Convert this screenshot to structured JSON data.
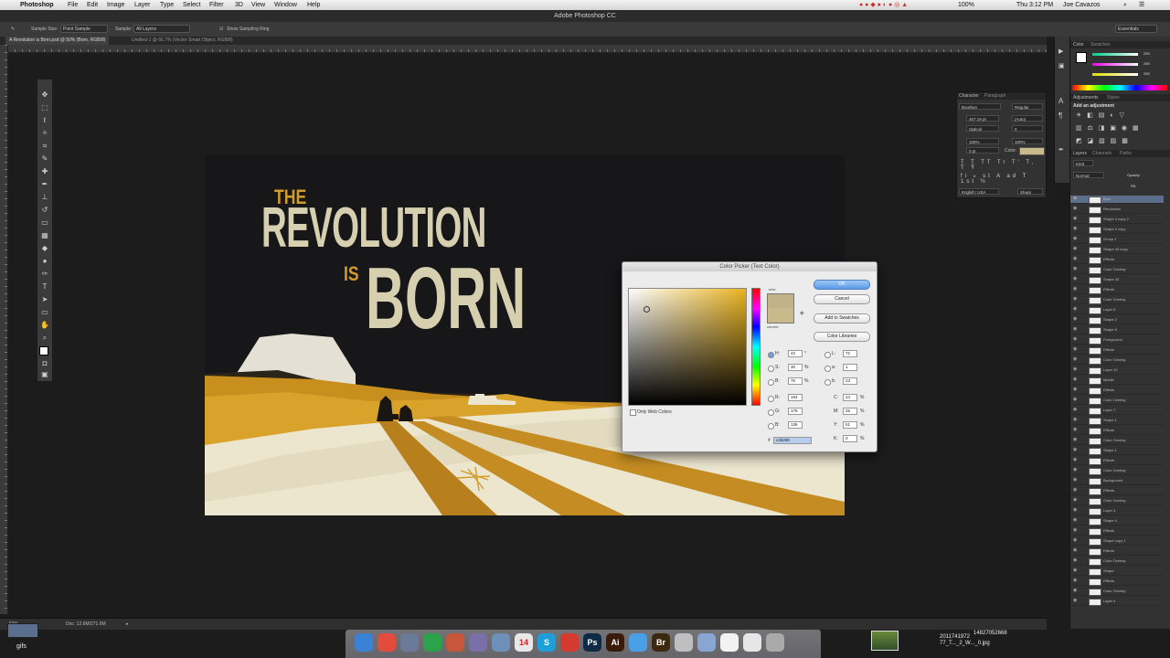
{
  "menubar": {
    "apple": "",
    "app": "Photoshop",
    "items": [
      "File",
      "Edit",
      "Image",
      "Layer",
      "Type",
      "Select",
      "Filter",
      "3D",
      "View",
      "Window",
      "Help"
    ],
    "battery": "100%",
    "clock": "Thu 3:12 PM",
    "user": "Joe Cavazos"
  },
  "window": {
    "title": "Adobe Photoshop CC"
  },
  "options": {
    "sample_size_label": "Sample Size:",
    "sample_size_value": "Point Sample",
    "sample_label": "Sample:",
    "sample_value": "All Layers",
    "show_ring": "Show Sampling Ring",
    "workspace": "Essentials"
  },
  "tabs": [
    {
      "label": "A Revolution is Born.psd @ 50% (Born, RGB/8)"
    },
    {
      "label": "Untitled-1 @ 66.7% (Vector Smart Object, RGB/8)"
    }
  ],
  "status": {
    "zoom": "50%",
    "doc": "Doc: 12.6M/271.9M"
  },
  "artwork": {
    "the": "THE",
    "revolution": "REVOLUTION",
    "is": "IS",
    "born": "BORN",
    "colors": {
      "gold": "#d39b2a",
      "cream": "#d6cfb0",
      "night": "#17171a",
      "sand": "#ece6cf"
    }
  },
  "picker": {
    "title": "Color Picker (Text Color)",
    "ok": "OK",
    "cancel": "Cancel",
    "add_swatches": "Add to Swatches",
    "libraries": "Color Libraries",
    "new_label": "new",
    "current_label": "current",
    "only_web": "Only Web Colors",
    "new_color": "#c2b288",
    "current_color": "#c9ba8c",
    "fields": [
      {
        "l": "H:",
        "v": "42",
        "u": "°"
      },
      {
        "l": "S:",
        "v": "30",
        "u": "%"
      },
      {
        "l": "B:",
        "v": "76",
        "u": "%"
      },
      {
        "l": "R:",
        "v": "194",
        "u": ""
      },
      {
        "l": "G:",
        "v": "178",
        "u": ""
      },
      {
        "l": "B:",
        "v": "136",
        "u": ""
      }
    ],
    "lab": [
      {
        "l": "L:",
        "v": "72",
        "u": ""
      },
      {
        "l": "a:",
        "v": "1",
        "u": ""
      },
      {
        "l": "b:",
        "v": "23",
        "u": ""
      },
      {
        "l": "C:",
        "v": "24",
        "u": "%"
      },
      {
        "l": "M:",
        "v": "25",
        "u": "%"
      },
      {
        "l": "Y:",
        "v": "51",
        "u": "%"
      },
      {
        "l": "K:",
        "v": "0",
        "u": "%"
      }
    ],
    "hex_label": "#",
    "hex": "c2b288"
  },
  "character": {
    "tabs": [
      "Character",
      "Paragraph"
    ],
    "font": "Bourbon",
    "style": "Regular",
    "size": "467.19 pt",
    "leading": "(Auto)",
    "kerning": "Optical",
    "tracking": "0",
    "vscale": "100%",
    "hscale": "100%",
    "baseline": "0 pt",
    "color_label": "Color:",
    "language": "English: USA",
    "aa": "Sharp"
  },
  "panels": {
    "color_tabs": [
      "Color",
      "Swatches"
    ],
    "rgb_values": [
      "255",
      "255",
      "255"
    ],
    "adj_tabs": [
      "Adjustments",
      "Styles"
    ],
    "add_adjustment": "Add an adjustment",
    "layers_tabs": [
      "Layers",
      "Channels",
      "Paths"
    ],
    "kind": "Kind",
    "blend": "Normal",
    "opacity": "Opacity:",
    "fill": "Fill:"
  },
  "layers": [
    {
      "name": "Born",
      "sel": true
    },
    {
      "name": "Revolution"
    },
    {
      "name": "Shape 4 copy 2"
    },
    {
      "name": "Shape 4 copy"
    },
    {
      "name": "Group 1"
    },
    {
      "name": "Shape 43 copy"
    },
    {
      "name": "Effects"
    },
    {
      "name": "Color Overlay"
    },
    {
      "name": "Shape 43"
    },
    {
      "name": "Effects"
    },
    {
      "name": "Color Overlay"
    },
    {
      "name": "Layer 6"
    },
    {
      "name": "Shape 2"
    },
    {
      "name": "Shape 8"
    },
    {
      "name": "Foreground"
    },
    {
      "name": "Effects"
    },
    {
      "name": "Color Overlay"
    },
    {
      "name": "Layer 10"
    },
    {
      "name": "Middle"
    },
    {
      "name": "Effects"
    },
    {
      "name": "Color Overlay"
    },
    {
      "name": "Layer 7"
    },
    {
      "name": "Shape 1"
    },
    {
      "name": "Effects"
    },
    {
      "name": "Color Overlay"
    },
    {
      "name": "Shape 1"
    },
    {
      "name": "Effects"
    },
    {
      "name": "Color Overlay"
    },
    {
      "name": "Background"
    },
    {
      "name": "Effects"
    },
    {
      "name": "Color Overlay"
    },
    {
      "name": "Layer 3"
    },
    {
      "name": "Shape 4"
    },
    {
      "name": "Effects"
    },
    {
      "name": "Shape copy 1"
    },
    {
      "name": "Effects"
    },
    {
      "name": "Color Overlay"
    },
    {
      "name": "Shape"
    },
    {
      "name": "Effects"
    },
    {
      "name": "Color Overlay"
    },
    {
      "name": "Layer 4"
    }
  ],
  "dock": {
    "items": [
      {
        "name": "finder-icon",
        "c": "#3b82d6",
        "t": ""
      },
      {
        "name": "chrome-icon",
        "c": "#e24c3c",
        "t": ""
      },
      {
        "name": "rocket-icon",
        "c": "#6b7a99",
        "t": ""
      },
      {
        "name": "spotify-icon",
        "c": "#2aa34a",
        "t": ""
      },
      {
        "name": "mail-icon",
        "c": "#c8563a",
        "t": ""
      },
      {
        "name": "messages-icon",
        "c": "#7a6fa8",
        "t": ""
      },
      {
        "name": "preview-icon",
        "c": "#6d8fb8",
        "t": ""
      },
      {
        "name": "calendar-icon",
        "c": "#e8e8e8",
        "t": "14"
      },
      {
        "name": "skype-icon",
        "c": "#1e9fd8",
        "t": "S"
      },
      {
        "name": "acrobat-icon",
        "c": "#d63a2e",
        "t": ""
      },
      {
        "name": "photoshop-icon",
        "c": "#0f2a44",
        "t": "Ps"
      },
      {
        "name": "illustrator-icon",
        "c": "#3a1b0a",
        "t": "Ai"
      },
      {
        "name": "chat-icon",
        "c": "#4aa0e6",
        "t": ""
      },
      {
        "name": "bridge-icon",
        "c": "#3b2a10",
        "t": "Br"
      },
      {
        "name": "disk-icon",
        "c": "#bfbfbf",
        "t": ""
      },
      {
        "name": "folder-icon",
        "c": "#88a6d1",
        "t": ""
      },
      {
        "name": "document-icon",
        "c": "#f2f2f2",
        "t": ""
      },
      {
        "name": "file-icon",
        "c": "#e6e6e6",
        "t": ""
      },
      {
        "name": "trash-icon",
        "c": "#aaaaaa",
        "t": ""
      }
    ]
  },
  "desktop": {
    "label": "gifs",
    "file1": "2011741972",
    "file1b": "77_T..._2_W..._0.jpg",
    "file2": "14827052668",
    "file2b": "...0.jpg"
  }
}
